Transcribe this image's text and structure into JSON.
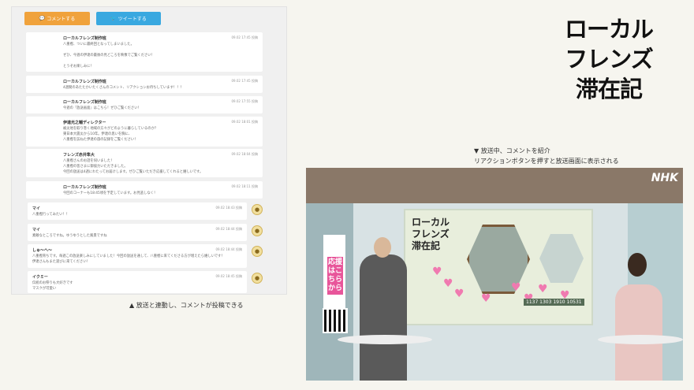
{
  "buttons": {
    "comment": "コメントする",
    "tweet": "ツイートする"
  },
  "comments": [
    {
      "name": "ローカルフレンズ制作班",
      "date": "09.02 17:45 投稿",
      "text": "八重樫、ついに最終回となってしまいました。\n\nぜひ、今週の伊達の最後の見どころを映像でご覧ください！\n\nとうぞお楽しみに！"
    },
    {
      "name": "ローカルフレンズ制作班",
      "date": "09.02 17:45 投稿",
      "text": "4週間のあたたかいたくさんのコメント、リアクションお待ちしています！！！"
    },
    {
      "name": "ローカルフレンズ制作班",
      "date": "09.02 17:55 投稿",
      "text": "今週の『放送画面』はこちら！ぜひご覧ください！"
    },
    {
      "name": "伊達光之輔ディレクター",
      "date": "09.02 18:01 投稿",
      "text": "被災地を取り巻く地域の方々がどのように暮らしているのか？\n東日本大震災から10年。伊達の思いを胸に、\n八重樫を訪ねた伊達の旅の記録をご覧ください！"
    },
    {
      "name": "フレンズ赤井隼大",
      "date": "09.02 18:04 投稿",
      "text": "八重樫さんのお話を伺いました！\n八重樫の皆さまに御協力いただきました。\n今回の放送は4週にわたってお届けします。ぜひご覧いただき応援してくれると嬉しいです。"
    },
    {
      "name": "ローカルフレンズ制作班",
      "date": "09.02 18:11 投稿",
      "text": "今回のコーナーも18:45頃を予定しています。お見逃しなく！"
    }
  ],
  "user_comments": [
    {
      "name": "マイ",
      "date": "09.02 18:43 投稿",
      "text": "八重樫行ってみたい！！"
    },
    {
      "name": "マイ",
      "date": "09.02 18:44 投稿",
      "text": "素敵なところですね。ゆうゆうとした風景ですね"
    },
    {
      "name": "しゅ〜へ〜",
      "date": "09.02 18:44 投稿",
      "text": "八重樫育ちです。毎週この放送楽しみにしていました！今回の放送を通して、八重樫に来てくださる方が増えたら嬉しいです！\n伊達さんもまた遊びに来てください！"
    },
    {
      "name": "イクミー",
      "date": "09.02 18:45 投稿",
      "text": "伝統のお祭りも大好きです\nマスクが可愛い"
    }
  ],
  "captions": {
    "left": "▲ 放送と連動し、コメントが投稿できる",
    "right_1": "▼ 放送中、コメントを紹介",
    "right_2": "リアクションボタンを押すと放送画面に表示される"
  },
  "logo": {
    "line1": "ローカル",
    "line2": "フレンズ",
    "line3": "滞在記"
  },
  "broadcast": {
    "channel": "NHK",
    "screen_title_1": "ローカル",
    "screen_title_2": "フレンズ",
    "screen_title_3": "滞在記",
    "support_text": "応援はこちらから",
    "stats": "1137  1303  1910  10531"
  },
  "colors": {
    "comment_button": "#f0a23c",
    "tweet_button": "#39a8e0"
  }
}
